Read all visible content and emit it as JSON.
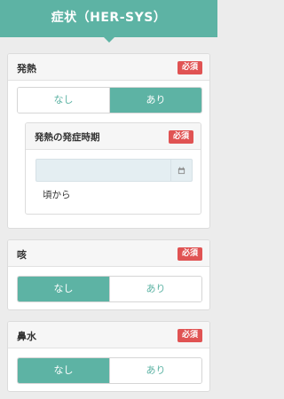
{
  "header": {
    "title": "症状（HER-SYS）"
  },
  "fever": {
    "label": "発熱",
    "required": "必須",
    "options": [
      "なし",
      "あり"
    ],
    "selected": "あり",
    "onset": {
      "label": "発熱の発症時期",
      "required": "必須",
      "date_value": "",
      "suffix": "頃から"
    }
  },
  "cough": {
    "label": "咳",
    "required": "必須",
    "options": [
      "なし",
      "あり"
    ],
    "selected": "なし"
  },
  "runny_nose": {
    "label": "鼻水",
    "required": "必須",
    "options": [
      "なし",
      "あり"
    ],
    "selected": "なし"
  },
  "colors": {
    "accent": "#5db3a4",
    "required_badge": "#e05353",
    "date_field": "#e4eef2"
  },
  "icons": {
    "calendar": "calendar-icon"
  }
}
